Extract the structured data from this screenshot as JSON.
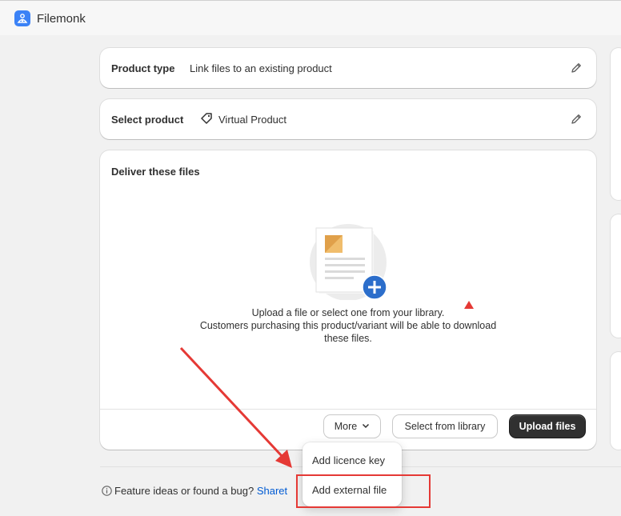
{
  "app": {
    "title": "Filemonk",
    "logo_icon": "filemonk-logo-icon"
  },
  "product_type": {
    "label": "Product type",
    "value": "Link files to an existing product",
    "edit_icon": "pencil-icon"
  },
  "select_product": {
    "label": "Select product",
    "value": "Virtual Product",
    "tag_icon": "tag-icon",
    "edit_icon": "pencil-icon"
  },
  "deliver": {
    "title": "Deliver these files",
    "empty_line1": "Upload a file or select one from your library.",
    "empty_line2": "Customers purchasing this product/variant will be able to download",
    "empty_line3": "these files.",
    "buttons": {
      "more": "More",
      "select_library": "Select from library",
      "upload": "Upload files"
    }
  },
  "more_menu": {
    "items": [
      "Add licence key",
      "Add external file"
    ]
  },
  "feedback": {
    "text": "Feature ideas or found a bug?",
    "link": "Share",
    "trailing": "t"
  },
  "colors": {
    "annotation": "#e53935",
    "accent": "#005bd3",
    "primary_button": "#303030",
    "plus_badge": "#2c6ecb"
  }
}
